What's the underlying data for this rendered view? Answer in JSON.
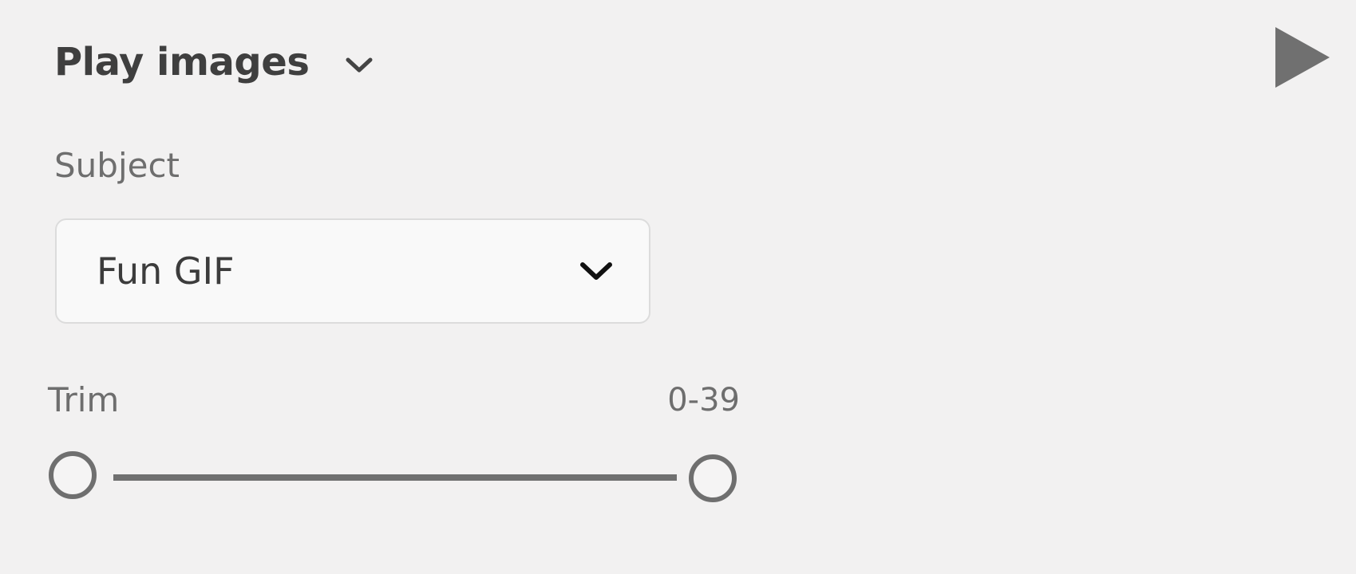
{
  "header": {
    "title": "Play images",
    "chevron_icon": "chevron-down-icon",
    "play_icon": "play-icon"
  },
  "subject": {
    "label": "Subject",
    "selected_value": "Fun GIF",
    "chevron_icon": "chevron-down-icon"
  },
  "trim": {
    "label": "Trim",
    "range_text": "0-39",
    "start_value": 0,
    "end_value": 39
  },
  "colors": {
    "background": "#f2f1f1",
    "title_text": "#3f3f3f",
    "secondary_text": "#6e6e6e",
    "control_gray": "#707070",
    "select_background": "#f9f9f9",
    "select_border": "#dcdcdc"
  }
}
